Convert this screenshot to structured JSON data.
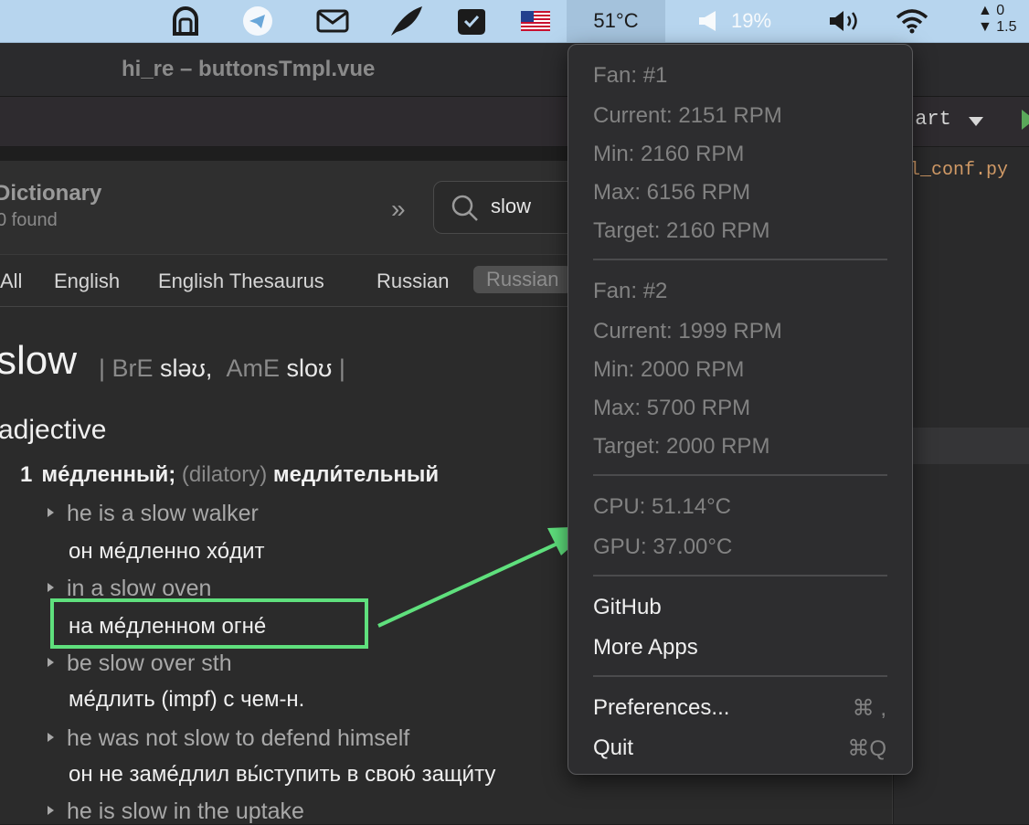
{
  "menubar": {
    "temperature": "51°C",
    "volume_level": "19%",
    "fan_stats": [
      "▲ 0",
      "▼ 1.5"
    ]
  },
  "editor": {
    "window_title": "hi_re – buttonsTmpl.vue",
    "run_config": "tart",
    "file_tab": "l_conf.py"
  },
  "dictionary": {
    "title": "Dictionary",
    "found": "0 found",
    "search_value": "slow",
    "tabs": [
      "All",
      "English",
      "English Thesaurus",
      "Russian",
      "Russian"
    ],
    "headword": "slow",
    "pron_bre_label": "BrE",
    "pron_bre": "sləʊ,",
    "pron_ame_label": "AmE",
    "pron_ame": "sloʊ",
    "part_of_speech": "adjective",
    "sense_number": "1",
    "sense_main": "ме́дленный;",
    "sense_gloss": "(dilatory)",
    "sense_alt": "медли́тельный",
    "examples": [
      {
        "en": "he is a slow walker",
        "ru": "он ме́дленно хо́дит"
      },
      {
        "en": "in a slow oven",
        "ru": "на ме́дленном огне́"
      },
      {
        "en": "be slow over sth",
        "ru": "ме́длить (impf) с чем-н."
      },
      {
        "en": "he was not slow to defend himself",
        "ru": "он не заме́длил вы́ступить в свою́ защи́ту"
      },
      {
        "en": "he is slow in the uptake",
        "ru": ""
      }
    ]
  },
  "menu": {
    "fan1": {
      "header": "Fan: #1",
      "current": "Current: 2151 RPM",
      "min": "Min: 2160 RPM",
      "max": "Max: 6156 RPM",
      "target": "Target: 2160 RPM"
    },
    "fan2": {
      "header": "Fan: #2",
      "current": "Current: 1999 RPM",
      "min": "Min: 2000 RPM",
      "max": "Max: 5700 RPM",
      "target": "Target: 2000 RPM"
    },
    "cpu": "CPU: 51.14°C",
    "gpu": "GPU: 37.00°C",
    "github": "GitHub",
    "more_apps": "More Apps",
    "preferences": "Preferences...",
    "preferences_shortcut": "⌘ ,",
    "quit": "Quit",
    "quit_shortcut": "⌘Q"
  },
  "colors": {
    "menubar_bg": "#b7d5ee",
    "highlight_green": "#5fe07d",
    "menu_bg": "#2d2d2f"
  }
}
